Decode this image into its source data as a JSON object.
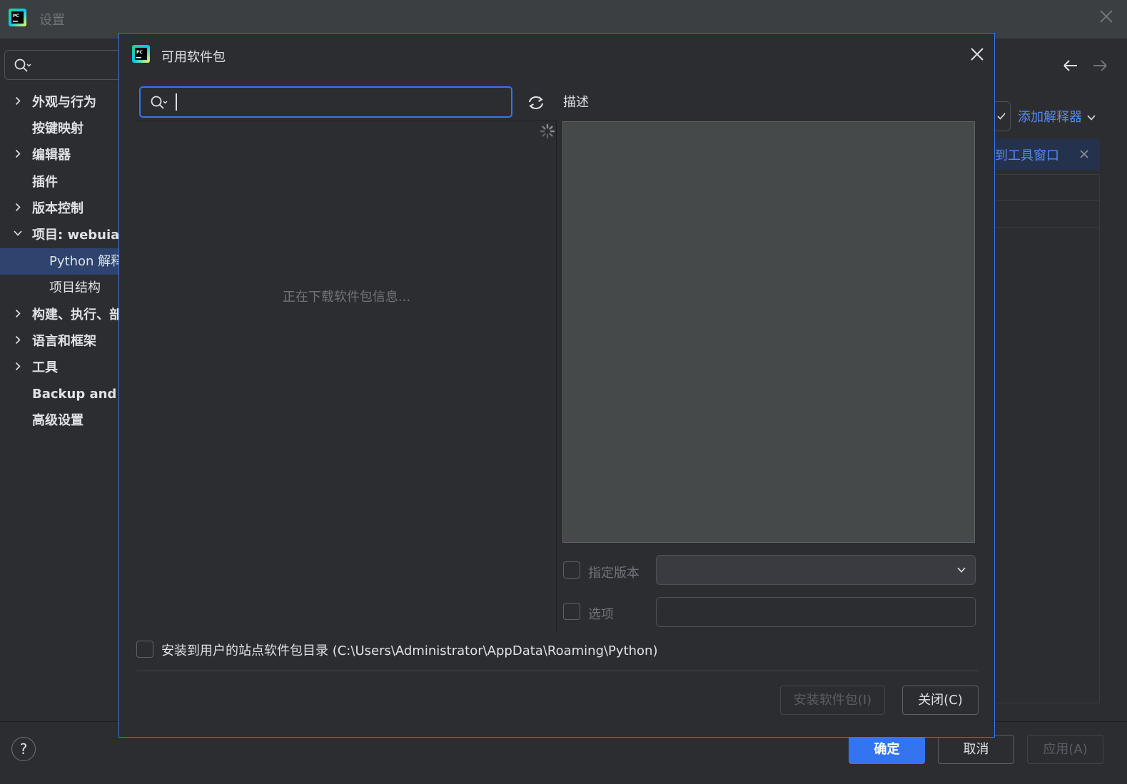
{
  "window": {
    "title": "设置",
    "icon": "pycharm-logo",
    "close_icon": "close-icon"
  },
  "sidebar": {
    "search_placeholder": "",
    "items": [
      {
        "label": "外观与行为",
        "expandable": true,
        "expanded": false,
        "level": 0
      },
      {
        "label": "按键映射",
        "expandable": false,
        "level": 0
      },
      {
        "label": "编辑器",
        "expandable": true,
        "expanded": false,
        "level": 0
      },
      {
        "label": "插件",
        "expandable": false,
        "level": 0
      },
      {
        "label": "版本控制",
        "expandable": true,
        "expanded": false,
        "level": 0
      },
      {
        "label": "项目: webuiau",
        "expandable": true,
        "expanded": true,
        "level": 0
      },
      {
        "label": "Python 解释",
        "expandable": false,
        "level": 1,
        "selected": true
      },
      {
        "label": "项目结构",
        "expandable": false,
        "level": 1
      },
      {
        "label": "构建、执行、部",
        "expandable": true,
        "expanded": false,
        "level": 0
      },
      {
        "label": "语言和框架",
        "expandable": true,
        "expanded": false,
        "level": 0
      },
      {
        "label": "工具",
        "expandable": true,
        "expanded": false,
        "level": 0
      },
      {
        "label": "Backup and Sy",
        "expandable": false,
        "level": 0
      },
      {
        "label": "高级设置",
        "expandable": false,
        "level": 0
      }
    ]
  },
  "main": {
    "add_interpreter": "添加解释器",
    "banner_text": "到工具窗口"
  },
  "footer": {
    "help": "?",
    "ok": "确定",
    "cancel": "取消",
    "apply": "应用(A)"
  },
  "dialog": {
    "title": "可用软件包",
    "search_value": "",
    "loading_text": "正在下载软件包信息...",
    "description_label": "描述",
    "specify_version_label": "指定版本",
    "specify_version_checked": false,
    "options_label": "选项",
    "options_checked": false,
    "options_value": "",
    "user_site_label": "安装到用户的站点软件包目录 (C:\\Users\\Administrator\\AppData\\Roaming\\Python)",
    "user_site_checked": false,
    "install_button": "安装软件包(I)",
    "close_button": "关闭(C)"
  },
  "colors": {
    "background": "#2b2d30",
    "titlebar": "#3c3f41",
    "accent": "#3574f0",
    "link": "#548af7",
    "selection": "#2e436e",
    "description_bg": "#45494a"
  }
}
